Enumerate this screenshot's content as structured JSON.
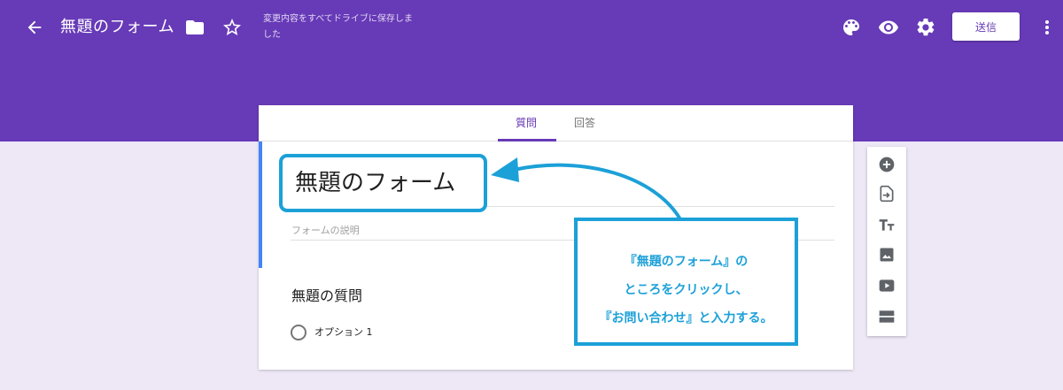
{
  "header": {
    "form_title": "無題のフォーム",
    "save_status": "変更内容をすべてドライブに保存しました",
    "send_label": "送信",
    "icons": [
      "back-arrow-icon",
      "folder-icon",
      "star-icon",
      "palette-icon",
      "eye-icon",
      "gear-icon",
      "more-vert-icon"
    ]
  },
  "tabs": [
    {
      "label": "質問",
      "active": true
    },
    {
      "label": "回答",
      "active": false
    }
  ],
  "form": {
    "title": "無題のフォーム",
    "description_placeholder": "フォームの説明",
    "question": {
      "title": "無題の質問",
      "options": [
        "オプション 1"
      ]
    }
  },
  "callout": {
    "lines": [
      "『無題のフォーム』の",
      "ところをクリックし、",
      "『お問い合わせ』と入力する。"
    ]
  },
  "toolbar": {
    "icons": [
      "add-question-icon",
      "import-questions-icon",
      "title-text-icon",
      "image-icon",
      "video-icon",
      "section-icon"
    ]
  },
  "colors": {
    "header": "#673ab7",
    "background": "#ede7f6",
    "callout": "#1ca0d8",
    "accent_bar": "#4285f4"
  }
}
